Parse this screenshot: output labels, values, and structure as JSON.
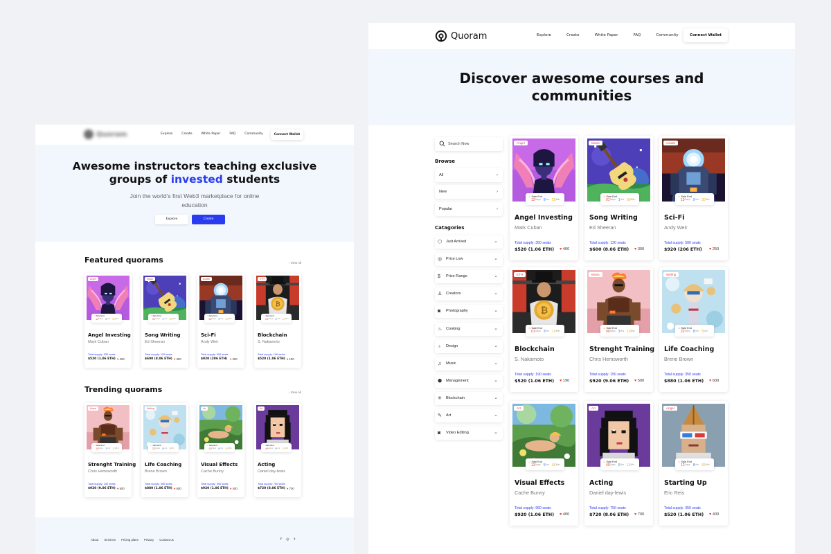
{
  "left": {
    "nav": {
      "links": [
        "Explore",
        "Create",
        "White Paper",
        "FAQ",
        "Community"
      ],
      "connect": "Connect Wallet",
      "logo_text": "Quoram"
    },
    "hero": {
      "title_line1": "Awesome instructors teaching exclusive",
      "title_pre": "groups of ",
      "title_highlight": "invested",
      "title_post": " students",
      "subtitle": "Join the world's first Web3 marketplace for online education",
      "explore": "Explore",
      "create": "Create"
    },
    "featured_title": "Featured quorams",
    "trending_title": "Trending quorams",
    "view_all": "View All",
    "featured": [
      {
        "tag": "Angel",
        "title": "Angel Investing",
        "author": "Mark Cuban",
        "supply": "Total supply: 350 seats",
        "price": "$520 (1.06 ETH)",
        "likes": "400",
        "timer": [
          "12",
          "8",
          "55"
        ]
      },
      {
        "tag": "Music",
        "title": "Song Writing",
        "author": "Ed Sheeran",
        "supply": "Total supply: 120 seats",
        "price": "$600 (8.06 ETH)",
        "likes": "300",
        "timer": [
          "01",
          "1",
          "09"
        ]
      },
      {
        "tag": "Avatar",
        "title": "Sci-Fi",
        "author": "Andy Weir",
        "supply": "Total supply: 500 seats",
        "price": "$920 (206 ETH)",
        "likes": "250",
        "timer": [
          "15",
          "9",
          "30"
        ]
      },
      {
        "tag": "ETH",
        "title": "Blockchain",
        "author": "S. Nakamoto",
        "supply": "Total supply: 190 seats",
        "price": "$520 (1.06 ETH)",
        "likes": "190",
        "timer": [
          "01",
          "3",
          "10"
        ]
      }
    ],
    "trending": [
      {
        "tag": "Music",
        "title": "Strenght Training",
        "author": "Chris Hemsworth",
        "supply": "Total supply: 150 seats",
        "price": "$920 (9.06 ETH)",
        "likes": "500",
        "timer": [
          "10",
          "3",
          "10"
        ]
      },
      {
        "tag": "Writing",
        "title": "Life Coaching",
        "author": "Brene Brown",
        "supply": "Total supply: 350 seats",
        "price": "$880 (1.06 ETH)",
        "likes": "600",
        "timer": [
          "22",
          "8",
          "5"
        ]
      },
      {
        "tag": "Art",
        "title": "Visual Effects",
        "author": "Cache Bunny",
        "supply": "Total supply: 950 seats",
        "price": "$920 (1.06 ETH)",
        "likes": "400",
        "timer": [
          "13",
          "6",
          "55"
        ]
      },
      {
        "tag": "Art",
        "title": "Acting",
        "author": "Daniel day-lewis",
        "supply": "Total supply: 750 seats",
        "price": "$720 (8.06 ETH)",
        "likes": "700",
        "timer": [
          "49",
          "6",
          "11"
        ]
      }
    ],
    "footer": {
      "links": [
        "About",
        "Services",
        "Pricing plans",
        "Privacy",
        "Contact us"
      ],
      "social": [
        "f",
        "◎",
        "t"
      ]
    }
  },
  "right": {
    "nav": {
      "logo_text": "Quoram",
      "links": [
        "Explore",
        "Create",
        "White Paper",
        "FAQ",
        "Community"
      ],
      "connect": "Connect Wallet"
    },
    "hero_title_line1": "Discover awesome courses and",
    "hero_title_line2": "communities",
    "search_placeholder": "Search Now",
    "browse_label": "Browse",
    "browse": [
      "All",
      "New",
      "Popular"
    ],
    "categories_label": "Catagories",
    "categories": [
      {
        "label": "Just Arrived",
        "icon": "box-icon",
        "glyph": "⬡"
      },
      {
        "label": "Price Low",
        "icon": "coin-icon",
        "glyph": "◎"
      },
      {
        "label": "Price Range",
        "icon": "dollar-icon",
        "glyph": "$"
      },
      {
        "label": "Creators",
        "icon": "person-icon",
        "glyph": "♙"
      },
      {
        "label": "Photography",
        "icon": "camera-icon",
        "glyph": "◙"
      },
      {
        "label": "Cooking",
        "icon": "cooking-icon",
        "glyph": "♨"
      },
      {
        "label": "Design",
        "icon": "bulb-icon",
        "glyph": "♁"
      },
      {
        "label": "Music",
        "icon": "music-icon",
        "glyph": "♫"
      },
      {
        "label": "Management",
        "icon": "cube-icon",
        "glyph": "⬢"
      },
      {
        "label": "Blockchain",
        "icon": "network-icon",
        "glyph": "✳"
      },
      {
        "label": "Art",
        "icon": "brush-icon",
        "glyph": "✎"
      },
      {
        "label": "Video Editing",
        "icon": "video-icon",
        "glyph": "◙"
      }
    ],
    "sale_label": "Sale End",
    "timer_units": [
      "Days",
      "Hrs",
      "Min"
    ],
    "cards": [
      {
        "tag": "Angel",
        "title": "Angel Investing",
        "author": "Mark Cuban",
        "supply": "Total supply: 350 seats",
        "price": "$520 (1.06 ETH)",
        "likes": "400",
        "timer": [
          "12",
          "8",
          "55"
        ]
      },
      {
        "tag": "Music",
        "title": "Song Writing",
        "author": "Ed Sheeran",
        "supply": "Total supply: 120 seats",
        "price": "$600 (8.06 ETH)",
        "likes": "300",
        "timer": [
          "01",
          "1",
          "09"
        ]
      },
      {
        "tag": "Avatar",
        "title": "Sci-Fi",
        "author": "Andy Weir",
        "supply": "Total supply: 500 seats",
        "price": "$920 (206 ETH)",
        "likes": "250",
        "timer": [
          "15",
          "9",
          "30"
        ]
      },
      {
        "tag": "ETH",
        "title": "Blockchain",
        "author": "S. Nakamoto",
        "supply": "Total supply: 190 seats",
        "price": "$520 (1.06 ETH)",
        "likes": "190",
        "timer": [
          "01",
          "3",
          "10"
        ]
      },
      {
        "tag": "Music",
        "title": "Strenght Training",
        "author": "Chris Hemsworth",
        "supply": "Total supply: 150 seats",
        "price": "$920 (9.06 ETH)",
        "likes": "500",
        "timer": [
          "00",
          "3",
          "10"
        ]
      },
      {
        "tag": "Writing",
        "title": "Life Coaching",
        "author": "Brene Brown",
        "supply": "Total supply: 350 seats",
        "price": "$880 (1.06 ETH)",
        "likes": "600",
        "timer": [
          "22",
          "8",
          "5"
        ]
      },
      {
        "tag": "Art",
        "title": "Visual Effects",
        "author": "Cache Bunny",
        "supply": "Total supply: 950 seats",
        "price": "$920 (1.06 ETH)",
        "likes": "400",
        "timer": [
          "13",
          "6",
          "55"
        ]
      },
      {
        "tag": "Art",
        "title": "Acting",
        "author": "Daniel day-lewis",
        "supply": "Total supply: 750 seats",
        "price": "$720 (8.06 ETH)",
        "likes": "700",
        "timer": [
          "49",
          "6",
          "11"
        ]
      },
      {
        "tag": "Angel",
        "title": "Starting Up",
        "author": "Eric Reis",
        "supply": "Total supply: 350 seats",
        "price": "$520 (1.06 ETH)",
        "likes": "400",
        "timer": [
          "12",
          "8",
          "55"
        ]
      }
    ]
  },
  "colors": {
    "accent": "#2a3cf0",
    "tag_red": "#e5484d",
    "hero_bg": "#f2f7fe",
    "heart": "#e83d3d"
  }
}
